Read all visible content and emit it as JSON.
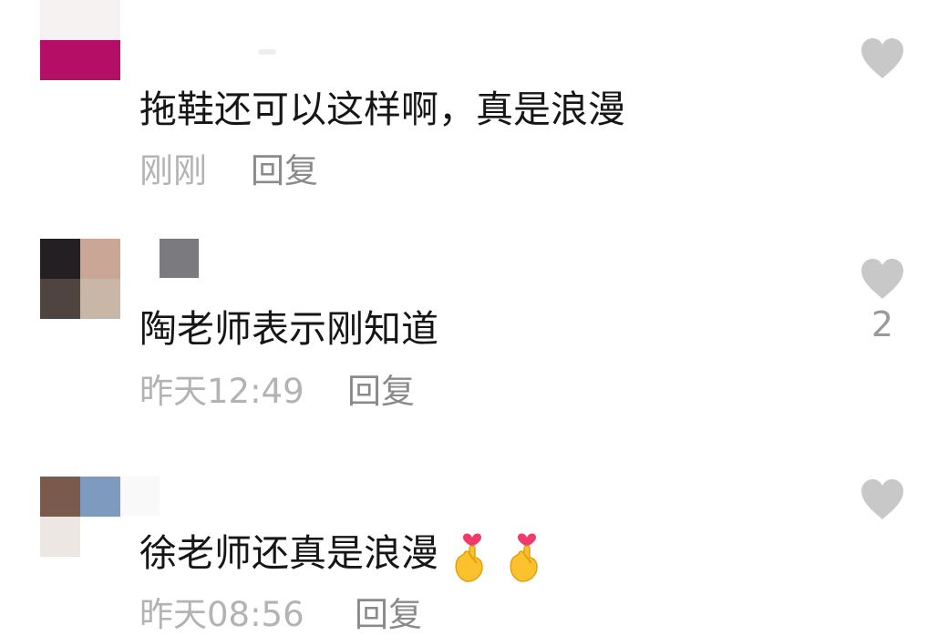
{
  "colors": {
    "text": "#161616",
    "meta": "#b3b3b3",
    "reply": "#8a8a8a",
    "heart": "#c8c8c8"
  },
  "comments": [
    {
      "text": "拖鞋还可以这样啊，真是浪漫",
      "time": "刚刚",
      "reply_label": "回复",
      "likes": "",
      "avatar_colors": [
        "#f7f2f2",
        "#f7f2f2",
        "#b50e66",
        "#b50e66"
      ]
    },
    {
      "text": "陶老师表示刚知道",
      "time": "昨天12:49",
      "reply_label": "回复",
      "likes": "2",
      "avatar_colors": [
        "#231f22",
        "#c9a696",
        "#4f4440",
        "#c8b6a6"
      ]
    },
    {
      "text": "徐老师还真是浪漫",
      "time": "昨天08:56",
      "reply_label": "回复",
      "likes": "",
      "emoji": [
        "hand-with-index-finger-and-thumb-crossed-emoji",
        "hand-with-index-finger-and-thumb-crossed-emoji"
      ],
      "avatar_colors": [
        "#7a5a4c",
        "#7e9bbf",
        "#ede7e3",
        "#ffffff"
      ]
    }
  ],
  "icons": {
    "like": "heart-icon"
  }
}
